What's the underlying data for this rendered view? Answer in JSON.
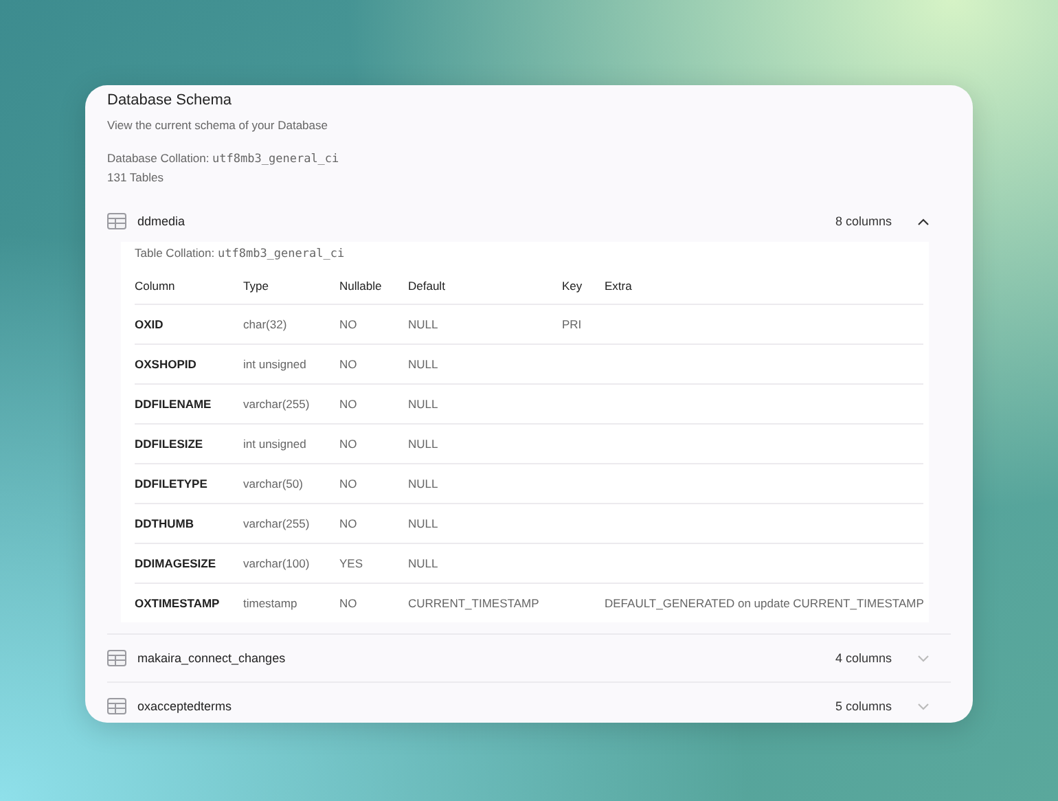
{
  "title": "Database Schema",
  "subtitle": "View the current schema of your Database",
  "collation_label": "Database Collation:",
  "collation": "utf8mb3_general_ci",
  "table_count": "131 Tables",
  "tables": [
    {
      "name": "ddmedia",
      "column_count": "8 columns",
      "expanded": true,
      "collation_label": "Table Collation:",
      "collation": "utf8mb3_general_ci",
      "columns": [
        "Column",
        "Type",
        "Nullable",
        "Default",
        "Key",
        "Extra"
      ],
      "rows": [
        [
          "OXID",
          "char(32)",
          "NO",
          "NULL",
          "PRI",
          ""
        ],
        [
          "OXSHOPID",
          "int unsigned",
          "NO",
          "NULL",
          "",
          ""
        ],
        [
          "DDFILENAME",
          "varchar(255)",
          "NO",
          "NULL",
          "",
          ""
        ],
        [
          "DDFILESIZE",
          "int unsigned",
          "NO",
          "NULL",
          "",
          ""
        ],
        [
          "DDFILETYPE",
          "varchar(50)",
          "NO",
          "NULL",
          "",
          ""
        ],
        [
          "DDTHUMB",
          "varchar(255)",
          "NO",
          "NULL",
          "",
          ""
        ],
        [
          "DDIMAGESIZE",
          "varchar(100)",
          "YES",
          "NULL",
          "",
          ""
        ],
        [
          "OXTIMESTAMP",
          "timestamp",
          "NO",
          "CURRENT_TIMESTAMP",
          "",
          "DEFAULT_GENERATED on update CURRENT_TIMESTAMP"
        ]
      ]
    },
    {
      "name": "makaira_connect_changes",
      "column_count": "4 columns",
      "expanded": false
    },
    {
      "name": "oxacceptedterms",
      "column_count": "5 columns",
      "expanded": false
    }
  ]
}
